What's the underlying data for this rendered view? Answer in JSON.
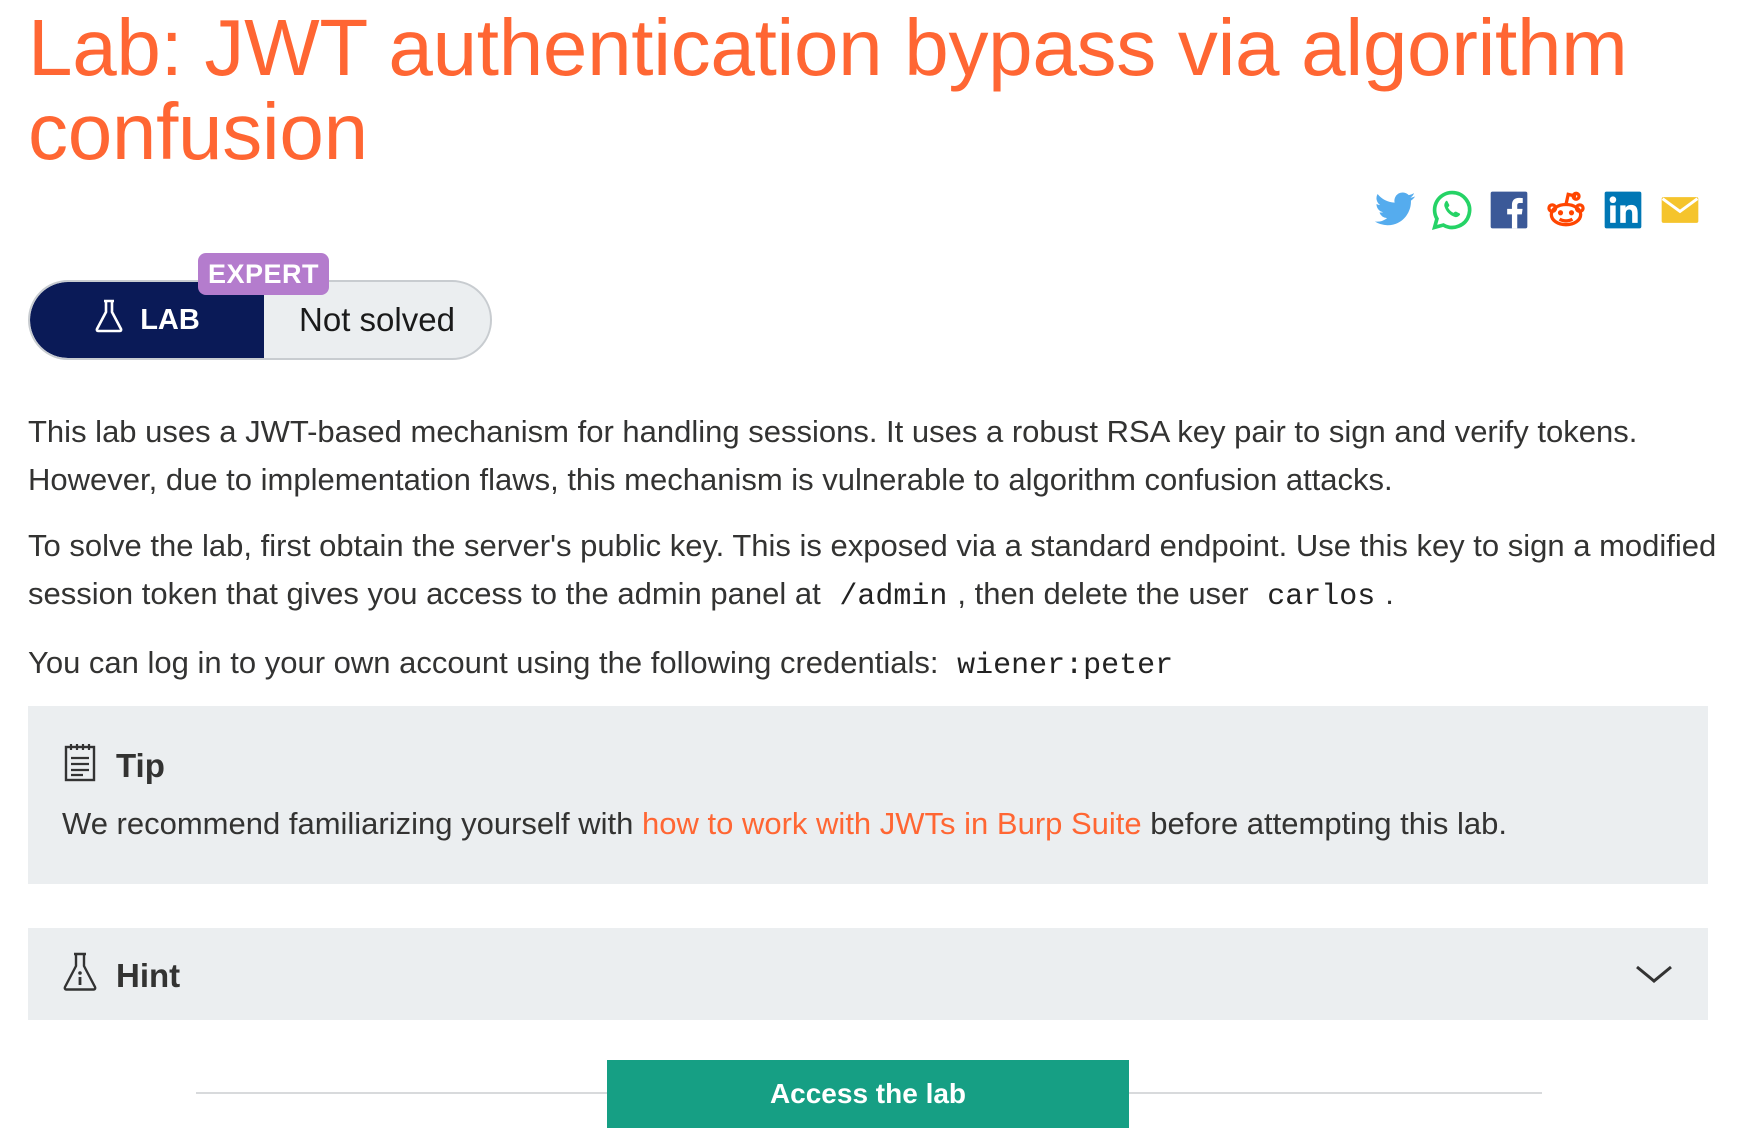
{
  "title": "Lab: JWT authentication bypass via algorithm confusion",
  "share": [
    {
      "name": "twitter-icon",
      "color": "#55acee"
    },
    {
      "name": "whatsapp-icon",
      "color": "#25d366"
    },
    {
      "name": "facebook-icon",
      "color": "#3b5998"
    },
    {
      "name": "reddit-icon",
      "color": "#ff4500"
    },
    {
      "name": "linkedin-icon",
      "color": "#0077b5"
    },
    {
      "name": "email-icon",
      "color": "#f5c42c"
    }
  ],
  "badge": {
    "level": "EXPERT",
    "lab_label": "LAB",
    "status": "Not solved"
  },
  "description": {
    "p1": "This lab uses a JWT-based mechanism for handling sessions. It uses a robust RSA key pair to sign and verify tokens. However, due to implementation flaws, this mechanism is vulnerable to algorithm confusion attacks.",
    "p2_before": "To solve the lab, first obtain the server's public key. This is exposed via a standard endpoint. Use this key to sign a modified session token that gives you access to the admin panel at",
    "p2_code1": "/admin",
    "p2_middle": ", then delete the user",
    "p2_code2": "carlos",
    "p2_after": ".",
    "p3_before": "You can log in to your own account using the following credentials:",
    "p3_code": "wiener:peter"
  },
  "tip": {
    "heading": "Tip",
    "before": "We recommend familiarizing yourself with",
    "link": "how to work with JWTs in Burp Suite",
    "after": "before attempting this lab."
  },
  "hint": {
    "heading": "Hint"
  },
  "access_button": "Access the lab",
  "colors": {
    "accent": "#ff6633",
    "lab_dark": "#0a1a57",
    "expert": "#b47ccd",
    "button": "#169f84"
  }
}
